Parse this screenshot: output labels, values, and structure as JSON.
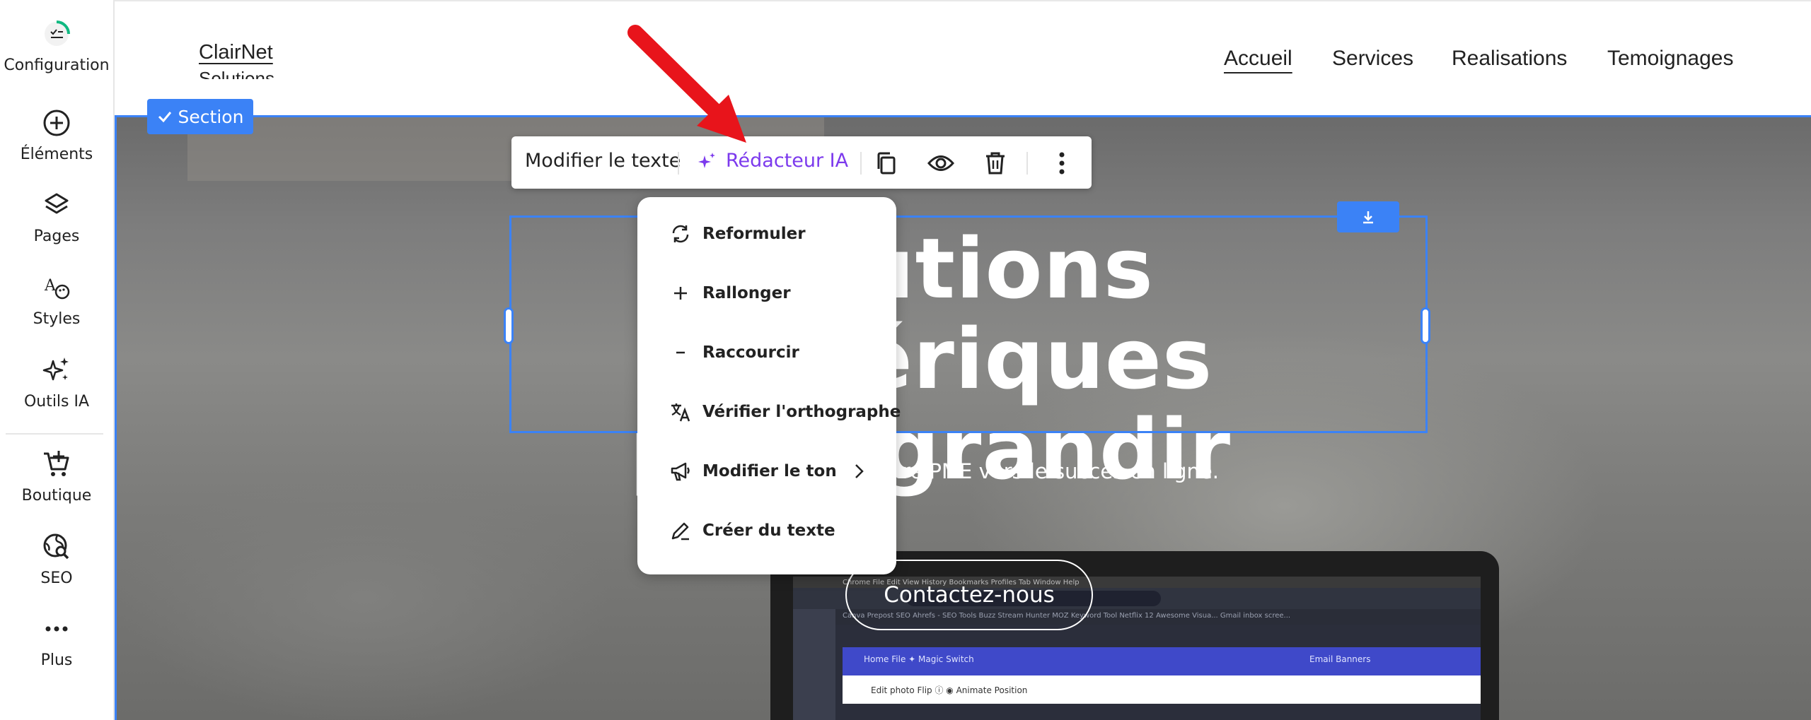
{
  "sidebar": {
    "items": [
      {
        "label": "Configuration",
        "icon": "setup-checklist-icon"
      },
      {
        "label": "Éléments",
        "icon": "add-circle-icon"
      },
      {
        "label": "Pages",
        "icon": "layers-icon"
      },
      {
        "label": "Styles",
        "icon": "styles-palette-icon"
      },
      {
        "label": "Outils IA",
        "icon": "sparkles-icon"
      },
      {
        "label": "Boutique",
        "icon": "cart-add-icon"
      },
      {
        "label": "SEO",
        "icon": "globe-search-icon"
      },
      {
        "label": "Plus",
        "icon": "more-dots-icon"
      }
    ],
    "accent": "#10b981"
  },
  "site": {
    "logo": "ClairNet",
    "logo_sub": "Solutions",
    "nav": [
      "Accueil",
      "Services",
      "Realisations",
      "Temoignages"
    ],
    "active_nav": "Accueil"
  },
  "hero": {
    "title_line1": "Solutions numériques",
    "title_line2": "pour grandir",
    "subtitle": "ClairNet accompagne votre PME vers le succès en ligne.",
    "cta": "Contactez-nous"
  },
  "editor": {
    "section_badge": "Section",
    "selection_color": "#3b82f6"
  },
  "toolbar": {
    "edit_text": "Modifier le texte",
    "ai_writer": "Rédacteur IA",
    "ai_color": "#7c3aed",
    "icons": [
      "duplicate-icon",
      "eye-icon",
      "trash-icon",
      "more-vertical-icon"
    ]
  },
  "ai_menu": {
    "items": [
      {
        "label": "Reformuler",
        "icon": "rephrase-icon"
      },
      {
        "label": "Rallonger",
        "icon": "plus-icon"
      },
      {
        "label": "Raccourcir",
        "icon": "minus-icon"
      },
      {
        "label": "Vérifier l'orthographe",
        "icon": "translate-icon"
      },
      {
        "label": "Modifier le ton",
        "icon": "megaphone-icon"
      },
      {
        "label": "Créer du texte",
        "icon": "pencil-icon"
      }
    ]
  },
  "annotation": {
    "arrow_color": "#e8141b"
  },
  "laptop_screen": {
    "tabs": "Canva   Prepost SEO   Ahrefs - SEO Tools   Buzz Stream   Hunter   MOZ   Keyword Tool   Netflix   12 Awesome Visua...   Gmail inbox scree...",
    "canva_menu": "Home     File     ✦ Magic Switch",
    "canva_right": "Email Banners",
    "canva_edit": "Edit photo    Flip    ⓘ    ◉ Animate    Position",
    "mac_menu": "Chrome   File   Edit   View   History   Bookmarks   Profiles   Tab   Window   Help"
  }
}
